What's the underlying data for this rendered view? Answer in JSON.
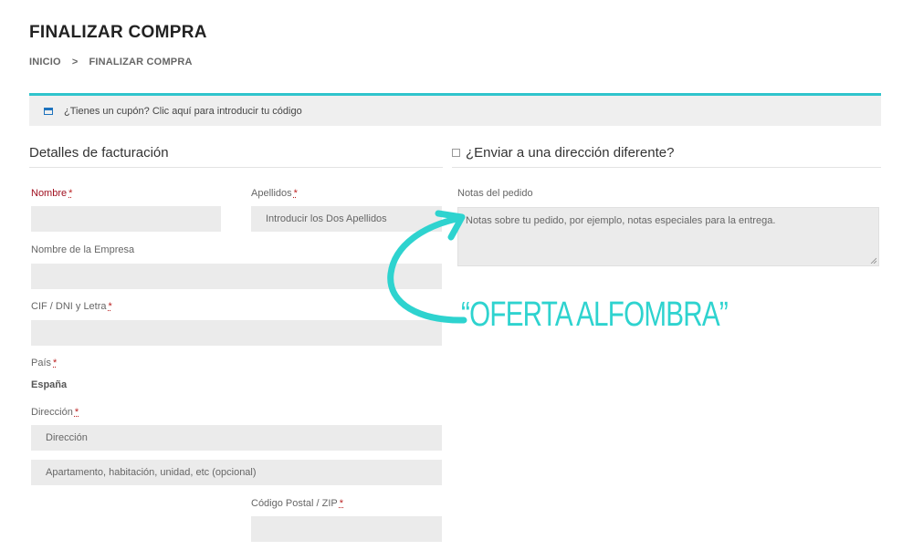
{
  "header": {
    "title": "FINALIZAR COMPRA",
    "breadcrumb": [
      "INICIO",
      ">",
      "FINALIZAR COMPRA"
    ]
  },
  "coupon": {
    "text": "¿Tienes un cupón? Clic aquí para introducir tu código",
    "accent_color": "#2fc4cc",
    "icon": "coupon-card-icon"
  },
  "billing": {
    "title": "Detalles de facturación",
    "fields": {
      "nombre_label": "Nombre",
      "apellidos_label": "Apellidos",
      "apellidos_placeholder": "Introducir los Dos Apellidos",
      "empresa_label": "Nombre de la Empresa",
      "cif_label": "CIF / DNI y Letra",
      "pais_label": "País",
      "pais_value": "España",
      "direccion_label": "Dirección",
      "direccion_placeholder": "Dirección",
      "direccion2_placeholder": "Apartamento, habitación, unidad, etc (opcional)",
      "postal_label": "Código Postal / ZIP"
    },
    "required_marker": "*"
  },
  "shipping": {
    "title": "¿Enviar a una dirección diferente?",
    "notes_label": "Notas del pedido",
    "notes_placeholder": "Notas sobre tu pedido, por ejemplo, notas especiales para la entrega."
  },
  "annotation": {
    "text": "“OFERTA ALFOMBRA”",
    "color": "#2ed3cf"
  }
}
